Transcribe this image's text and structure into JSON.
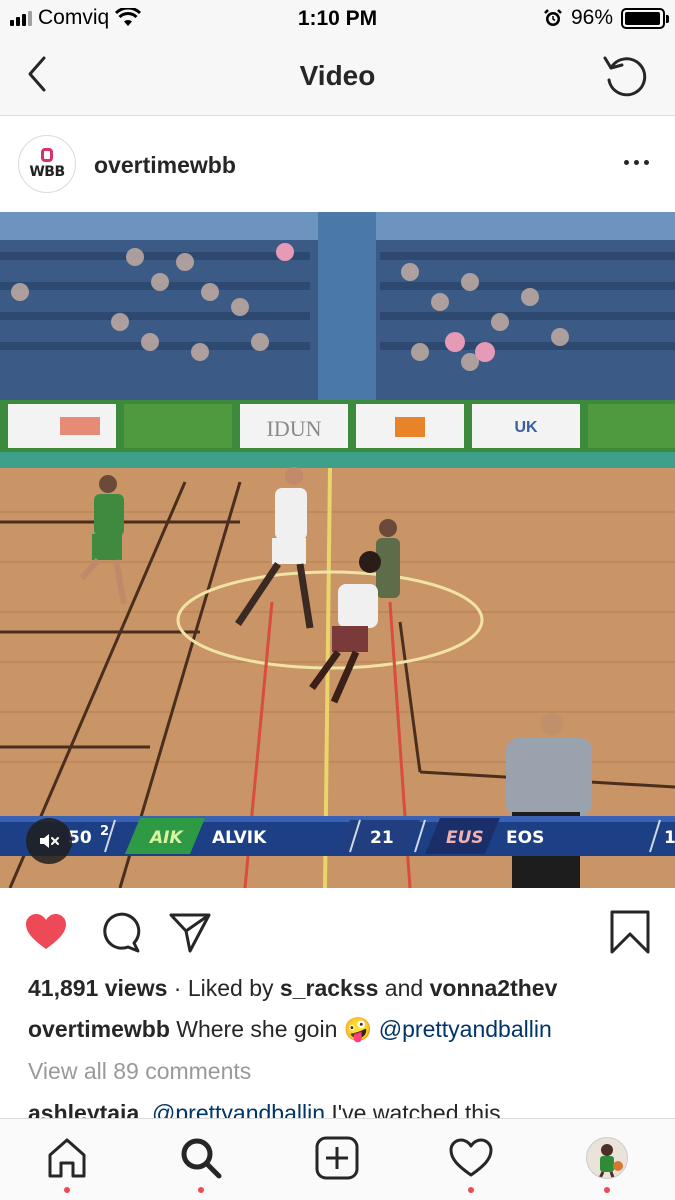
{
  "status_bar": {
    "carrier": "Comviq",
    "time": "1:10 PM",
    "battery": "96%",
    "battery_level": 0.96,
    "icons": [
      "signal-icon",
      "wifi-icon",
      "alarm-icon",
      "battery-icon"
    ]
  },
  "header": {
    "title": "Video",
    "back_icon": "chevron-left-icon",
    "refresh_icon": "refresh-icon"
  },
  "post": {
    "username": "overtimewbb",
    "avatar_text": "WBB",
    "more_icon": "more-icon"
  },
  "video": {
    "scoreboard": {
      "left_score": "50",
      "left_period": "2",
      "team_home_logo": "AIK",
      "team_home": "ALVIK",
      "home_score": "21",
      "team_away_logo": "EUS",
      "team_away": "EOS",
      "away_score": "1"
    },
    "ad_boards": [
      "IDUN",
      "UK"
    ],
    "mute_icon": "speaker-muted-icon"
  },
  "actions": {
    "icons": [
      "heart-filled-icon",
      "comment-icon",
      "share-icon",
      "bookmark-icon"
    ],
    "liked": true,
    "like_color": "#ed4956"
  },
  "stats": {
    "views_count": "41,891 views",
    "liked_by_prefix": " · Liked by ",
    "liked_by_user1": "s_rackss",
    "liked_by_and": " and ",
    "liked_by_user2": "vonna2thev"
  },
  "caption": {
    "username": "overtimewbb",
    "text": " Where she goin ",
    "emoji": "🤪",
    "mention": "@prettyandballin"
  },
  "comments": {
    "view_all": "View all 89 comments",
    "preview_user": "ashleytaia",
    "preview_mention": "@prettyandballin",
    "preview_text": " I've watched this"
  },
  "tabbar": {
    "items": [
      "home-icon",
      "search-icon",
      "add-post-icon",
      "activity-icon",
      "profile-avatar"
    ],
    "dot_color": "#ed4956"
  }
}
